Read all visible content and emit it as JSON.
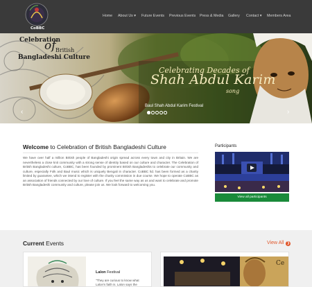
{
  "header": {
    "logo_text": "CoBBC",
    "nav": [
      "Home",
      "About Us ▾",
      "Future Events",
      "Previous Events",
      "Press & Media",
      "Gallery",
      "Contact ▾",
      "Members Area"
    ]
  },
  "hero": {
    "cobbc_line1": "Celebration",
    "cobbc_of": "of",
    "cobbc_line2": "British",
    "cobbc_line3": "Bangladeshi Culture",
    "celebrating": "Celebrating Decades of",
    "artist": "Shah Abdul Karim",
    "song": "song",
    "caption": "Baul Shah Abdul Karim Festival",
    "prev_arrow": "‹",
    "next_arrow": "›",
    "active_slide": 1,
    "slide_count": 5
  },
  "welcome": {
    "title_bold": "Welcome",
    "title_rest": " to Celebration of British Bangladeshi Culture",
    "body": "We have over half a million British people of Bangladeshi origin spread across every town and city in Britain. We are nevertheless a close knit community with a strong sense of identity based on our culture and character. The Celebration of British Bangladeshi culture, CoBBC, has been founded by prominent British Bangladeshis to celebrate our community and culture, especially Folk and Baul music which is uniquely Bengali in character. CoBBC ltd. has been formed as a charity limited by guarantee, which we intend to register with the charity commission in due course. We hope to operate CoBBC as an association of friends connected by our love of culture. If you feel the same way as us and want to celebrate and promote British Bangladeshi community and culture, please join us. We look forward to welcoming you."
  },
  "participants": {
    "title": "Participants",
    "button": "View all participants"
  },
  "events": {
    "title_bold": "Current",
    "title_rest": " Events",
    "view_all": "View All",
    "view_all_icon": "❯",
    "card1_title_bold": "Lalon",
    "card1_title_rest": " Festival",
    "card1_text": "\"They are curious to know what Lalon's faith is. Lalon says the",
    "card2_text": "Ce"
  },
  "colors": {
    "header_bg": "#3a3a3a",
    "accent_green": "#1a8a3a",
    "accent_orange": "#e0562a"
  }
}
